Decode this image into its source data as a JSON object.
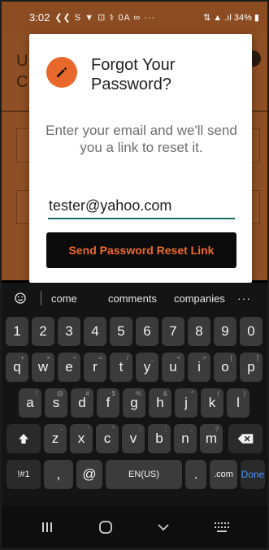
{
  "status_bar": {
    "time": "3:02",
    "notification_icons": "❮❮ S ▼ ⊡ ⚕ 0A ∞ ···",
    "right": "⇅ ▲ .ıl 34% ▮"
  },
  "dialog": {
    "title": "Forgot Your Password?",
    "message": "Enter your email and we'll send you a link to reset it.",
    "email_value": "tester@yahoo.com",
    "button_label": "Send Password Reset Link",
    "accent_color": "#e8672b",
    "button_text_color": "#f06a2c",
    "underline_color": "#1d6b5e"
  },
  "keyboard": {
    "suggestions": [
      "come",
      "comments",
      "companies"
    ],
    "more": "···",
    "rows": [
      {
        "keys": [
          {
            "label": "1"
          },
          {
            "label": "2"
          },
          {
            "label": "3"
          },
          {
            "label": "4"
          },
          {
            "label": "5"
          },
          {
            "label": "6"
          },
          {
            "label": "7"
          },
          {
            "label": "8"
          },
          {
            "label": "9"
          },
          {
            "label": "0"
          }
        ]
      },
      {
        "keys": [
          {
            "label": "q",
            "sup": "+"
          },
          {
            "label": "w",
            "sup": "×"
          },
          {
            "label": "e",
            "sup": "÷"
          },
          {
            "label": "r",
            "sup": "="
          },
          {
            "label": "t",
            "sup": "/"
          },
          {
            "label": "y",
            "sup": "_"
          },
          {
            "label": "u",
            "sup": "<"
          },
          {
            "label": "i",
            "sup": ">"
          },
          {
            "label": "o",
            "sup": "["
          },
          {
            "label": "p",
            "sup": "]"
          }
        ]
      },
      {
        "keys": [
          {
            "label": "a",
            "sup": "!"
          },
          {
            "label": "s",
            "sup": "@"
          },
          {
            "label": "d",
            "sup": "#"
          },
          {
            "label": "f",
            "sup": "$"
          },
          {
            "label": "g",
            "sup": "%"
          },
          {
            "label": "h",
            "sup": "&"
          },
          {
            "label": "j",
            "sup": "*"
          },
          {
            "label": "k",
            "sup": "("
          },
          {
            "label": "l",
            "sup": ")"
          }
        ]
      },
      {
        "keys": [
          {
            "label": "z",
            "sup": "-"
          },
          {
            "label": "x",
            "sup": "'"
          },
          {
            "label": "c",
            "sup": "\""
          },
          {
            "label": "v",
            "sup": ":"
          },
          {
            "label": "b",
            "sup": ";"
          },
          {
            "label": "n",
            "sup": ","
          },
          {
            "label": "m",
            "sup": "?"
          }
        ]
      }
    ],
    "bottom_row": {
      "symbols": "!#1",
      "comma": ",",
      "at": "@",
      "language": "EN(US)",
      "period": ".",
      "dotcom": ".com",
      "done": "Done"
    }
  },
  "icons": {
    "edit": "pencil-icon",
    "emoji": "emoji-icon",
    "shift": "shift-icon",
    "backspace": "backspace-icon",
    "nav_recents": "recents-icon",
    "nav_home": "home-icon",
    "nav_back": "back-icon",
    "nav_keyboard": "keyboard-icon"
  }
}
